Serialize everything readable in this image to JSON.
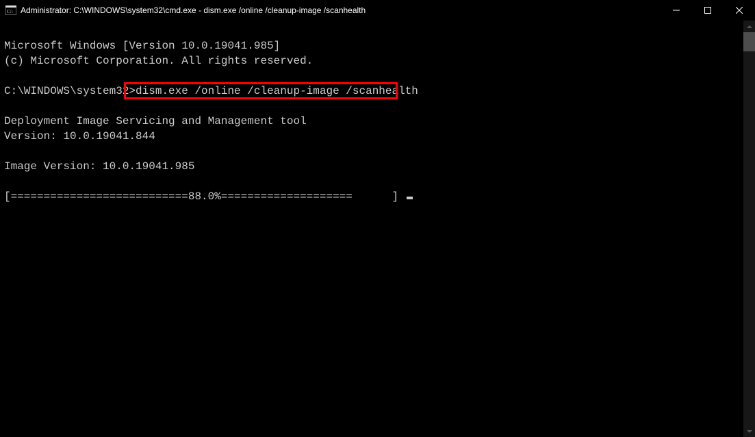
{
  "titlebar": {
    "title": "Administrator: C:\\WINDOWS\\system32\\cmd.exe - dism.exe  /online /cleanup-image /scanhealth"
  },
  "terminal": {
    "line_ms_windows": "Microsoft Windows [Version 10.0.19041.985]",
    "line_copyright": "(c) Microsoft Corporation. All rights reserved.",
    "prompt_path": "C:\\WINDOWS\\system32>",
    "command": "dism.exe /online /cleanup-image /scanhealth",
    "line_dism_tool": "Deployment Image Servicing and Management tool",
    "line_dism_version": "Version: 10.0.19041.844",
    "line_image_version": "Image Version: 10.0.19041.985",
    "progress_line": "[===========================88.0%====================      ] "
  }
}
